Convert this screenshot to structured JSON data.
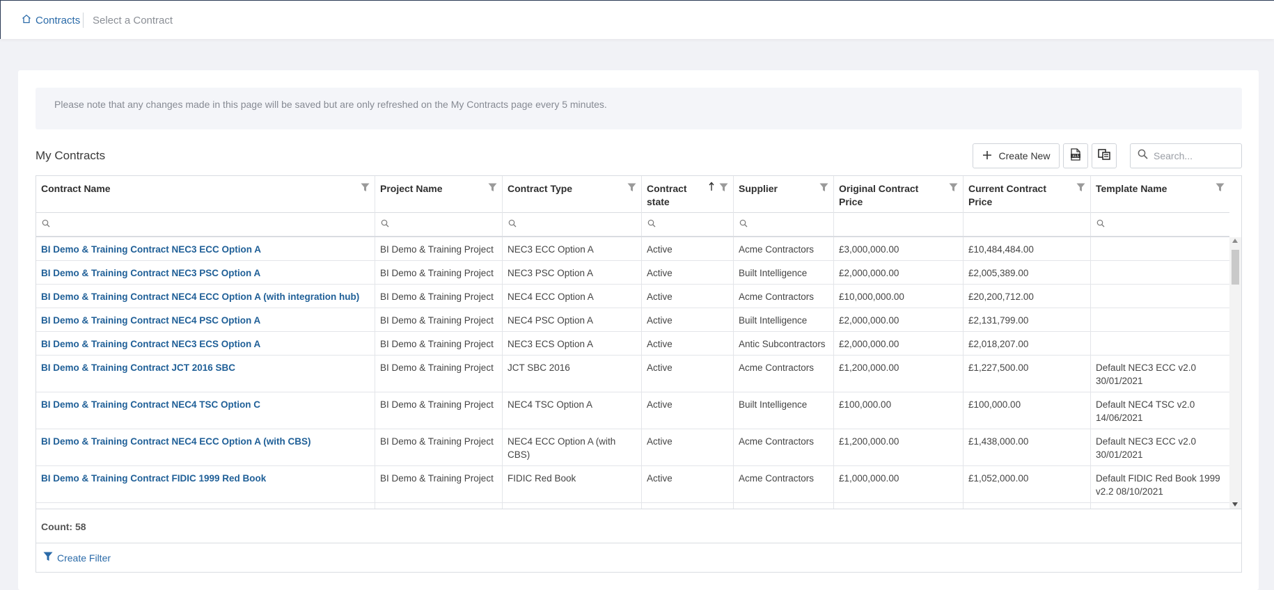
{
  "breadcrumb": {
    "home_label": "Contracts",
    "current": "Select a Contract"
  },
  "notice": "Please note that any changes made in this page will be saved but are only refreshed on the My Contracts page every 5 minutes.",
  "section_title": "My Contracts",
  "toolbar": {
    "create_label": "Create New",
    "search_placeholder": "Search..."
  },
  "columns": [
    "Contract Name",
    "Project Name",
    "Contract Type",
    "Contract state",
    "Supplier",
    "Original Contract Price",
    "Current Contract Price",
    "Template Name"
  ],
  "rows": [
    [
      "BI Demo & Training Contract NEC3 ECC Option A",
      "BI Demo & Training Project",
      "NEC3 ECC Option A",
      "Active",
      "Acme Contractors",
      "£3,000,000.00",
      "£10,484,484.00",
      ""
    ],
    [
      "BI Demo & Training Contract NEC3 PSC Option A",
      "BI Demo & Training Project",
      "NEC3 PSC Option A",
      "Active",
      "Built Intelligence",
      "£2,000,000.00",
      "£2,005,389.00",
      ""
    ],
    [
      "BI Demo & Training Contract NEC4 ECC Option A (with integration hub)",
      "BI Demo & Training Project",
      "NEC4 ECC Option A",
      "Active",
      "Acme Contractors",
      "£10,000,000.00",
      "£20,200,712.00",
      ""
    ],
    [
      "BI Demo & Training Contract NEC4 PSC Option A",
      "BI Demo & Training Project",
      "NEC4 PSC Option A",
      "Active",
      "Built Intelligence",
      "£2,000,000.00",
      "£2,131,799.00",
      ""
    ],
    [
      "BI Demo & Training Contract NEC3 ECS Option A",
      "BI Demo & Training Project",
      "NEC3 ECS Option A",
      "Active",
      "Antic Subcontractors",
      "£2,000,000.00",
      "£2,018,207.00",
      ""
    ],
    [
      "BI Demo & Training Contract JCT 2016 SBC",
      "BI Demo & Training Project",
      "JCT SBC 2016",
      "Active",
      "Acme Contractors",
      "£1,200,000.00",
      "£1,227,500.00",
      "Default NEC3 ECC v2.0 30/01/2021"
    ],
    [
      "BI Demo & Training Contract NEC4 TSC Option C",
      "BI Demo & Training Project",
      "NEC4 TSC Option A",
      "Active",
      "Built Intelligence",
      "£100,000.00",
      "£100,000.00",
      "Default NEC4 TSC v2.0 14/06/2021"
    ],
    [
      "BI Demo & Training Contract NEC4 ECC Option A (with CBS)",
      "BI Demo & Training Project",
      "NEC4 ECC Option A (with CBS)",
      "Active",
      "Acme Contractors",
      "£1,200,000.00",
      "£1,438,000.00",
      "Default NEC3 ECC v2.0 30/01/2021"
    ],
    [
      "BI Demo & Training Contract FIDIC 1999 Red Book",
      "BI Demo & Training Project",
      "FIDIC Red Book",
      "Active",
      "Acme Contractors",
      "£1,000,000.00",
      "£1,052,000.00",
      "Default FIDIC Red Book 1999 v2.2 08/10/2021"
    ],
    [
      "",
      "",
      "",
      "",
      "",
      "",
      "",
      ""
    ]
  ],
  "row_heights": [
    "h1",
    "h1",
    "h1",
    "h1",
    "h1",
    "h2",
    "h2",
    "h2",
    "h2",
    "h1"
  ],
  "count_label": "Count: 58",
  "create_filter_label": "Create Filter",
  "colors": {
    "link": "#1f5f97",
    "accent": "#2a6aa8",
    "border": "#d9dce1"
  }
}
